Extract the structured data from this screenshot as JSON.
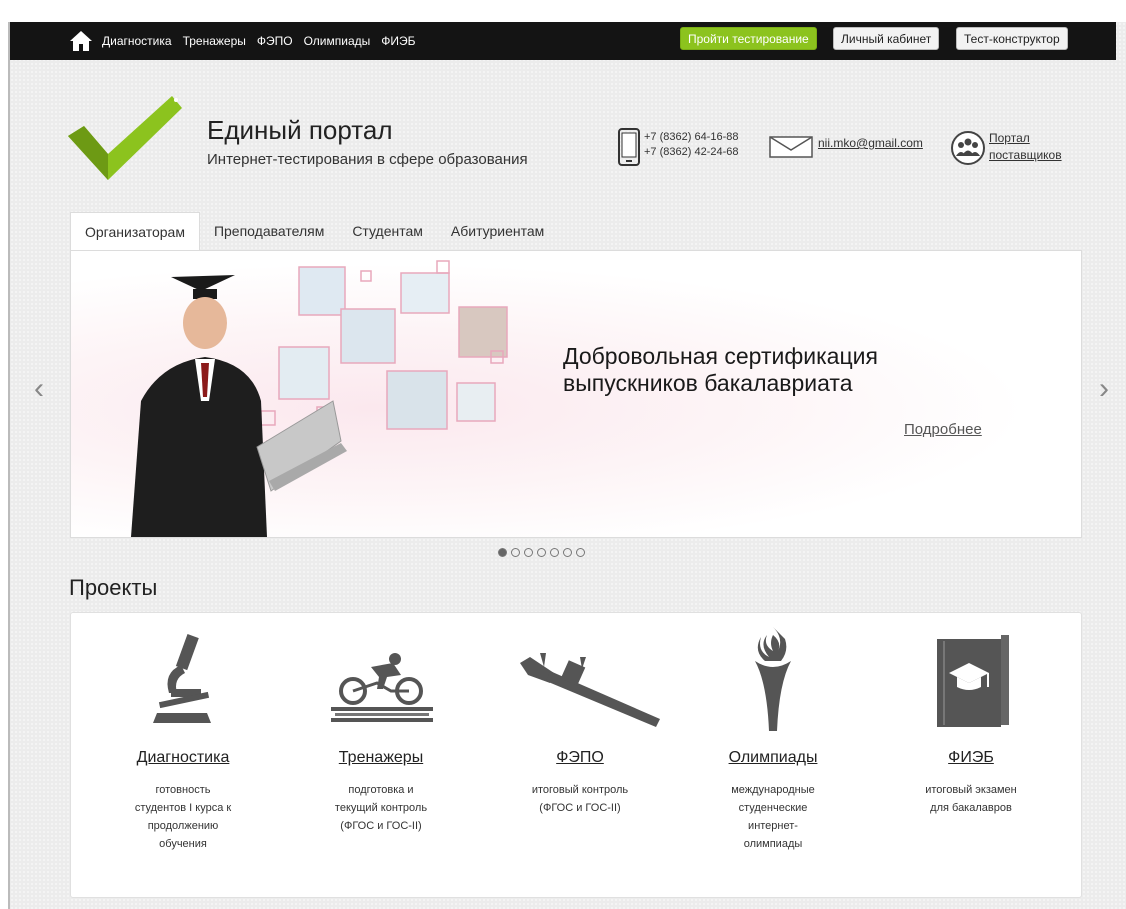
{
  "topbar": {
    "nav": [
      "Диагностика",
      "Тренажеры",
      "ФЭПО",
      "Олимпиады",
      "ФИЭБ"
    ],
    "btn_test": "Пройти тестирование",
    "btn_cabinet": "Личный кабинет",
    "btn_constructor": "Тест-конструктор"
  },
  "header": {
    "title": "Единый портал",
    "subtitle": "Интернет-тестирования в сфере образования",
    "phone1": "+7 (8362) 64-16-88",
    "phone2": "+7 (8362) 42-24-68",
    "email": "nii.mko@gmail.com",
    "supplier_line1": "Портал",
    "supplier_line2": "поставщиков"
  },
  "tabs": [
    "Организаторам",
    "Преподавателям",
    "Студентам",
    "Абитуриентам"
  ],
  "slider": {
    "line1": "Добровольная сертификация",
    "line2": "выпускников бакалавриата",
    "more": "Подробнее",
    "active_dot": 1,
    "dot_count": 7
  },
  "projects": {
    "title": "Проекты",
    "items": [
      {
        "title": "Диагностика",
        "desc": [
          "готовность",
          "студентов I курса к",
          "продолжению",
          "обучения"
        ],
        "icon": "microscope-icon"
      },
      {
        "title": "Тренажеры",
        "desc": [
          "подготовка и",
          "текущий контроль",
          "(ФГОС и ГОС-II)"
        ],
        "icon": "cyclist-icon"
      },
      {
        "title": "ФЭПО",
        "desc": [
          "итоговый контроль",
          "(ФГОС и ГОС-II)"
        ],
        "icon": "caliper-icon"
      },
      {
        "title": "Олимпиады",
        "desc": [
          "международные",
          "студенческие",
          "интернет-",
          "олимпиады"
        ],
        "icon": "torch-icon"
      },
      {
        "title": "ФИЭБ",
        "desc": [
          "итоговый экзамен",
          "для бакалавров"
        ],
        "icon": "diploma-book-icon"
      }
    ]
  },
  "colors": {
    "accent_green": "#8cc31e",
    "topbar_bg": "#141414"
  }
}
